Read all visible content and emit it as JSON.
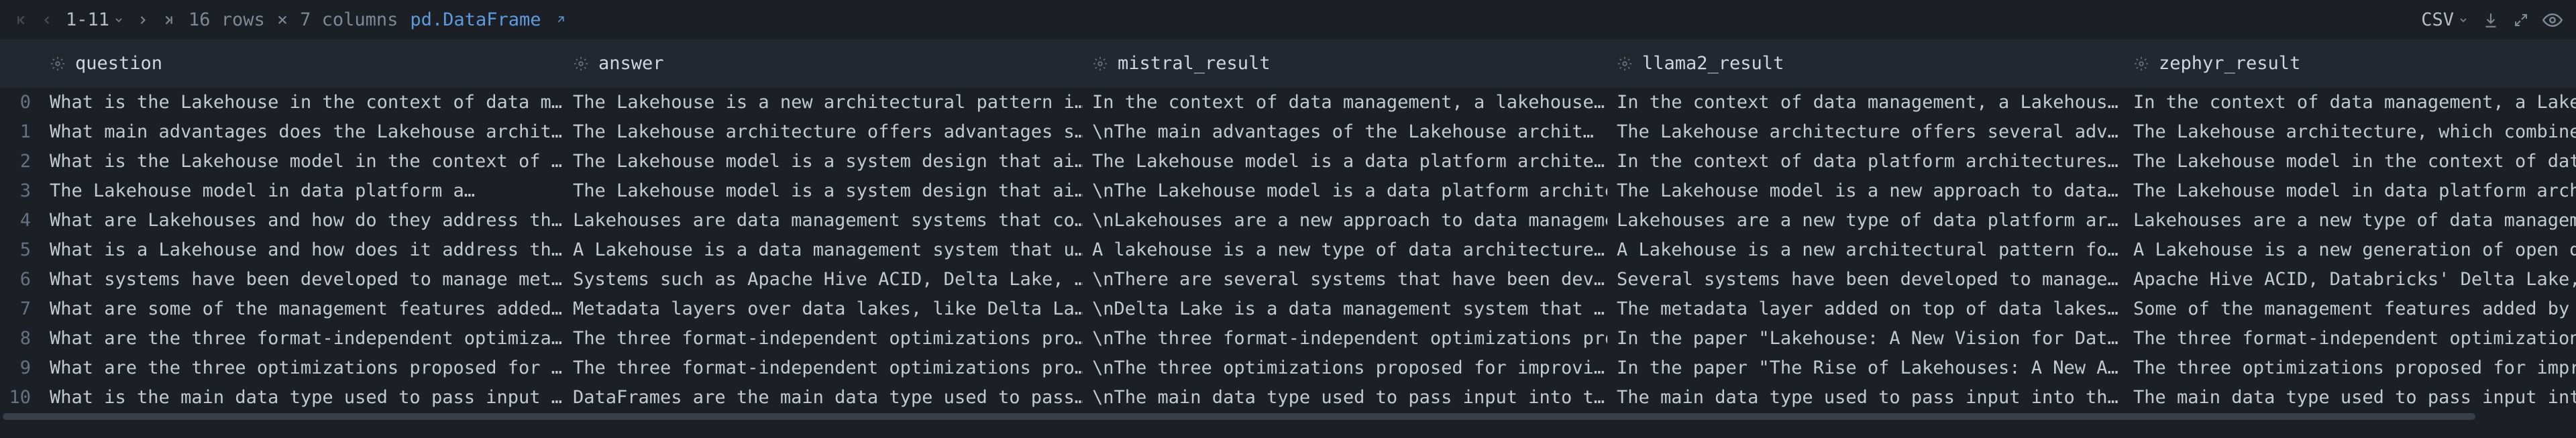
{
  "toolbar": {
    "range": "1-11",
    "dimensions_rows": "16 rows",
    "dimensions_sep": "×",
    "dimensions_cols": "7 columns",
    "dataframe_type": "pd.DataFrame",
    "csv_label": "CSV"
  },
  "columns": [
    {
      "key": "question",
      "label": "question"
    },
    {
      "key": "answer",
      "label": "answer"
    },
    {
      "key": "mistral_result",
      "label": "mistral_result"
    },
    {
      "key": "llama2_result",
      "label": "llama2_result"
    },
    {
      "key": "zephyr_result",
      "label": "zephyr_result"
    }
  ],
  "rows": [
    {
      "idx": "0",
      "question": "What is the Lakehouse in the context of data m…",
      "answer": "The Lakehouse is a new architectural pattern i…",
      "mistral_result": "In the context of data management, a lakehouse…",
      "llama2_result": "In the context of data management, a Lakehous…",
      "zephyr_result": "In the context of data management, a Lakehous"
    },
    {
      "idx": "1",
      "question": "What main advantages does the Lakehouse archit…",
      "answer": "The Lakehouse architecture offers advantages s…",
      "mistral_result": "\\nThe main advantages of the Lakehouse archit…",
      "llama2_result": "The Lakehouse architecture offers several adv…",
      "zephyr_result": "The Lakehouse architecture, which combines th"
    },
    {
      "idx": "2",
      "question": "What is the Lakehouse model in the context of …",
      "answer": "The Lakehouse model is a system design that ai…",
      "mistral_result": "The Lakehouse model is a data platform archite…",
      "llama2_result": "In the context of data platform architectures…",
      "zephyr_result": "The Lakehouse model in the context of data pl"
    },
    {
      "idx": "3",
      "question": "The Lakehouse model in data platform a…",
      "answer": "The Lakehouse model is a system design that ai…",
      "mistral_result": "\\nThe Lakehouse model is a data platform archite…",
      "llama2_result": "The Lakehouse model is a new approach to data…",
      "zephyr_result": "The Lakehouse model in data platform architec"
    },
    {
      "idx": "4",
      "question": "What are Lakehouses and how do they address th…",
      "answer": "Lakehouses are data management systems that co…",
      "mistral_result": "\\nLakehouses are a new approach to data manageme…",
      "llama2_result": "Lakehouses are a new type of data platform ar…",
      "zephyr_result": "Lakehouses are a new type of data management"
    },
    {
      "idx": "5",
      "question": "What is a Lakehouse and how does it address th…",
      "answer": "A Lakehouse is a data management system that u…",
      "mistral_result": "A lakehouse is a new type of data architecture…",
      "llama2_result": "A Lakehouse is a new architectural pattern fo…",
      "zephyr_result": "A Lakehouse is a new generation of open data"
    },
    {
      "idx": "6",
      "question": "What systems have been developed to manage met…",
      "answer": "Systems such as Apache Hive ACID, Delta Lake, …",
      "mistral_result": "\\nThere are several systems that have been dev…",
      "llama2_result": "Several systems have been developed to manage…",
      "zephyr_result": "Apache Hive ACID, Databricks' Delta Lake, Apa"
    },
    {
      "idx": "7",
      "question": "What are some of the management features added…",
      "answer": "Metadata layers over data lakes, like Delta La…",
      "mistral_result": "\\nDelta Lake is a data management system that …",
      "llama2_result": "The metadata layer added on top of data lakes…",
      "zephyr_result": "Some of the management features added by meta"
    },
    {
      "idx": "8",
      "question": "What are the three format-independent optimiza…",
      "answer": "The three format-independent optimizations pro…",
      "mistral_result": "\\nThe three format-independent optimizations pro…",
      "llama2_result": "In the paper \"Lakehouse: A New Vision for Dat…",
      "zephyr_result": "The three format-independent optimizations pr"
    },
    {
      "idx": "9",
      "question": "What are the three optimizations proposed for …",
      "answer": "The three format-independent optimizations pro…",
      "mistral_result": "\\nThe three optimizations proposed for improvi…",
      "llama2_result": "In the paper \"The Rise of Lakehouses: A New A…",
      "zephyr_result": "The three optimizations proposed for improvin"
    },
    {
      "idx": "10",
      "question": "What is the main data type used to pass input …",
      "answer": "DataFrames are the main data type used to pass…",
      "mistral_result": "\\nThe main data type used to pass input into t…",
      "llama2_result": "The main data type used to pass input into th…",
      "zephyr_result": "The main data type used to pass input into th"
    }
  ]
}
